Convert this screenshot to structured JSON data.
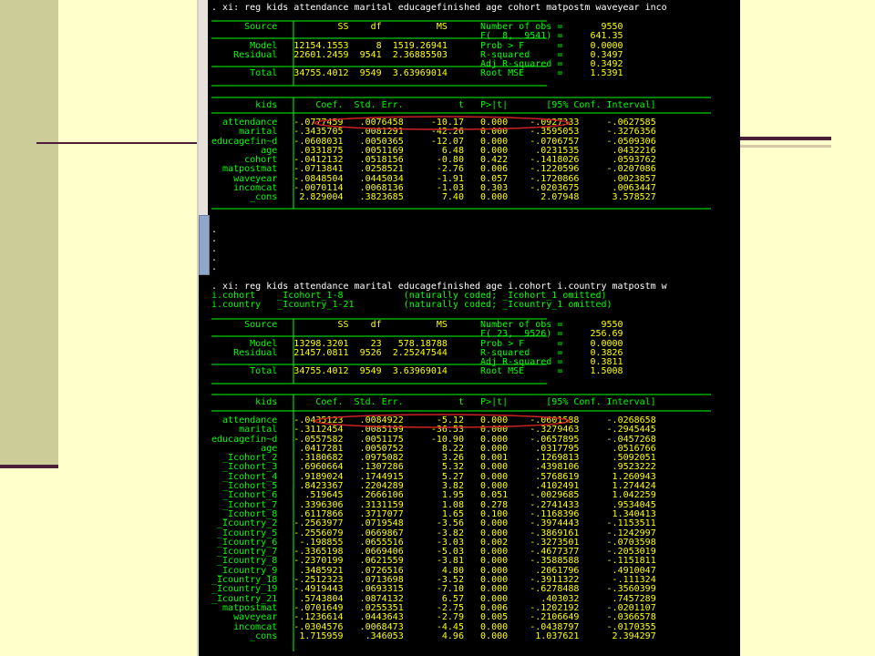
{
  "console": {
    "cmd1": ". xi: reg kids attendance marital educagefinished age cohort matpostm waveyear inco",
    "anova1": [
      [
        "Source",
        "SS",
        "df",
        "MS",
        "Number of obs =",
        "9550"
      ],
      [
        "",
        "",
        "",
        "",
        "F(  8,  9541) =",
        "641.35"
      ],
      [
        "Model",
        "12154.1553",
        "8",
        "1519.26941",
        "Prob > F      =",
        "0.0000"
      ],
      [
        "Residual",
        "22601.2459",
        "9541",
        "2.36885503",
        "R-squared     =",
        "0.3497"
      ],
      [
        "",
        "",
        "",
        "",
        "Adj R-squared =",
        "0.3492"
      ],
      [
        "Total",
        "34755.4012",
        "9549",
        "3.63969014",
        "Root MSE      =",
        "1.5391"
      ]
    ],
    "coef_header": [
      "kids",
      "Coef.",
      "Std. Err.",
      "t",
      "P>|t|",
      "[95% Conf. Interval]"
    ],
    "coef1": [
      [
        "attendance",
        "-.0777459",
        ".0076458",
        "-10.17",
        "0.000",
        "-.0927333",
        "-.0627585"
      ],
      [
        "marital",
        "-.3435705",
        ".0081291",
        "-42.26",
        "0.000",
        "-.3595053",
        "-.3276356"
      ],
      [
        "educagefin~d",
        "-.0608031",
        ".0050365",
        "-12.07",
        "0.000",
        "-.0706757",
        "-.0509306"
      ],
      [
        "age",
        ".0331875",
        ".0051169",
        "6.48",
        "0.000",
        ".0231535",
        ".0432216"
      ],
      [
        "cohort",
        "-.0412132",
        ".0518156",
        "-0.80",
        "0.422",
        "-.1418026",
        ".0593762"
      ],
      [
        "matpostmat",
        "-.0713841",
        ".0258521",
        "-2.76",
        "0.006",
        "-.1220596",
        "-.0207086"
      ],
      [
        "waveyear",
        "-.0848504",
        ".0445034",
        "-1.91",
        "0.057",
        "-.1720866",
        ".0023857"
      ],
      [
        "incomcat",
        "-.0070114",
        ".0068136",
        "-1.03",
        "0.303",
        "-.0203675",
        ".0063447"
      ],
      [
        "_cons",
        "2.829004",
        ".3823685",
        "7.40",
        "0.000",
        "2.07948",
        "3.578527"
      ]
    ],
    "dots": [
      ".",
      ".",
      ".",
      ".",
      "."
    ],
    "cmd2": ". xi: reg kids attendance marital educagefinished age i.cohort i.country matpostm w",
    "xi_lines": [
      [
        "i.cohort",
        "_Icohort_1-8",
        "(naturally coded; _Icohort_1 omitted)"
      ],
      [
        "i.country",
        "_Icountry_1-21",
        "(naturally coded; _Icountry_1 omitted)"
      ]
    ],
    "anova2": [
      [
        "Source",
        "SS",
        "df",
        "MS",
        "Number of obs =",
        "9550"
      ],
      [
        "",
        "",
        "",
        "",
        "F( 23,  9526) =",
        "256.69"
      ],
      [
        "Model",
        "13298.3201",
        "23",
        "578.18788",
        "Prob > F      =",
        "0.0000"
      ],
      [
        "Residual",
        "21457.0811",
        "9526",
        "2.25247544",
        "R-squared     =",
        "0.3826"
      ],
      [
        "",
        "",
        "",
        "",
        "Adj R-squared =",
        "0.3811"
      ],
      [
        "Total",
        "34755.4012",
        "9549",
        "3.63969014",
        "Root MSE      =",
        "1.5008"
      ]
    ],
    "coef2": [
      [
        "attendance",
        "-.0435123",
        ".0084922",
        "-5.12",
        "0.000",
        "-.0601588",
        "-.0268658"
      ],
      [
        "marital",
        "-.3112454",
        ".0085199",
        "-36.53",
        "0.000",
        "-.3279463",
        "-.2945445"
      ],
      [
        "educagefin~d",
        "-.0557582",
        ".0051175",
        "-10.90",
        "0.000",
        "-.0657895",
        "-.0457268"
      ],
      [
        "age",
        ".0417281",
        ".0050752",
        "8.22",
        "0.000",
        ".0317795",
        ".0516766"
      ],
      [
        "_Icohort_2",
        ".3180682",
        ".0975082",
        "3.26",
        "0.001",
        ".1269813",
        ".5092051"
      ],
      [
        "_Icohort_3",
        ".6960664",
        ".1307286",
        "5.32",
        "0.000",
        ".4398106",
        ".9523222"
      ],
      [
        "_Icohort_4",
        ".9189024",
        ".1744915",
        "5.27",
        "0.000",
        ".5768619",
        "1.260943"
      ],
      [
        "_Icohort_5",
        ".8423367",
        ".2204289",
        "3.82",
        "0.000",
        ".4102491",
        "1.274424"
      ],
      [
        "_Icohort_6",
        ".519645",
        ".2666106",
        "1.95",
        "0.051",
        "-.0029685",
        "1.042259"
      ],
      [
        "_Icohort_7",
        ".3396306",
        ".3131159",
        "1.08",
        "0.278",
        "-.2741433",
        ".9534045"
      ],
      [
        "_Icohort_8",
        ".6117866",
        ".3717077",
        "1.65",
        "0.100",
        "-.1168396",
        "1.340413"
      ],
      [
        "_Icountry_2",
        "-.2563977",
        ".0719548",
        "-3.56",
        "0.000",
        "-.3974443",
        "-.1153511"
      ],
      [
        "_Icountry_5",
        "-.2556079",
        ".0669867",
        "-3.82",
        "0.000",
        "-.3869161",
        "-.1242997"
      ],
      [
        "_Icountry_6",
        "-.198855",
        ".0655516",
        "-3.03",
        "0.002",
        "-.3273501",
        "-.0703598"
      ],
      [
        "_Icountry_7",
        "-.3365198",
        ".0669406",
        "-5.03",
        "0.000",
        "-.4677377",
        "-.2053019"
      ],
      [
        "_Icountry_8",
        "-.2370199",
        ".0621559",
        "-3.81",
        "0.000",
        "-.3588588",
        "-.1151811"
      ],
      [
        "_Icountry_9",
        ".3485921",
        ".0726516",
        "4.80",
        "0.000",
        ".2061796",
        ".4910047"
      ],
      [
        "_Icountry_18",
        "-.2512323",
        ".0713698",
        "-3.52",
        "0.000",
        "-.3911322",
        "-.111324"
      ],
      [
        "_Icountry_19",
        "-.4919443",
        ".0693315",
        "-7.10",
        "0.000",
        "-.6278488",
        "-.3560399"
      ],
      [
        "_Icountry_21",
        ".5743804",
        ".0874132",
        "6.57",
        "0.000",
        ".403032",
        ".7457289"
      ],
      [
        "matpostmat",
        "-.0701649",
        ".0255351",
        "-2.75",
        "0.006",
        "-.1202192",
        "-.0201107"
      ],
      [
        "waveyear",
        "-.1236614",
        ".0443643",
        "-2.79",
        "0.005",
        "-.2106649",
        "-.0366578"
      ],
      [
        "incomcat",
        "-.0304576",
        ".0068473",
        "-4.45",
        "0.000",
        "-.0438797",
        "-.0170355"
      ],
      [
        "_cons",
        "1.715959",
        ".346053",
        "4.96",
        "0.000",
        "1.037621",
        "2.394297"
      ]
    ]
  },
  "colors": {
    "slide_bg": "#FFFFCC",
    "side_panel": "#CCCC99",
    "accent_line": "#4B1E3A",
    "console_bg": "#000000",
    "console_text": "#00FF00",
    "console_value": "#FFFF00",
    "highlight_oval": "#CC2222"
  }
}
